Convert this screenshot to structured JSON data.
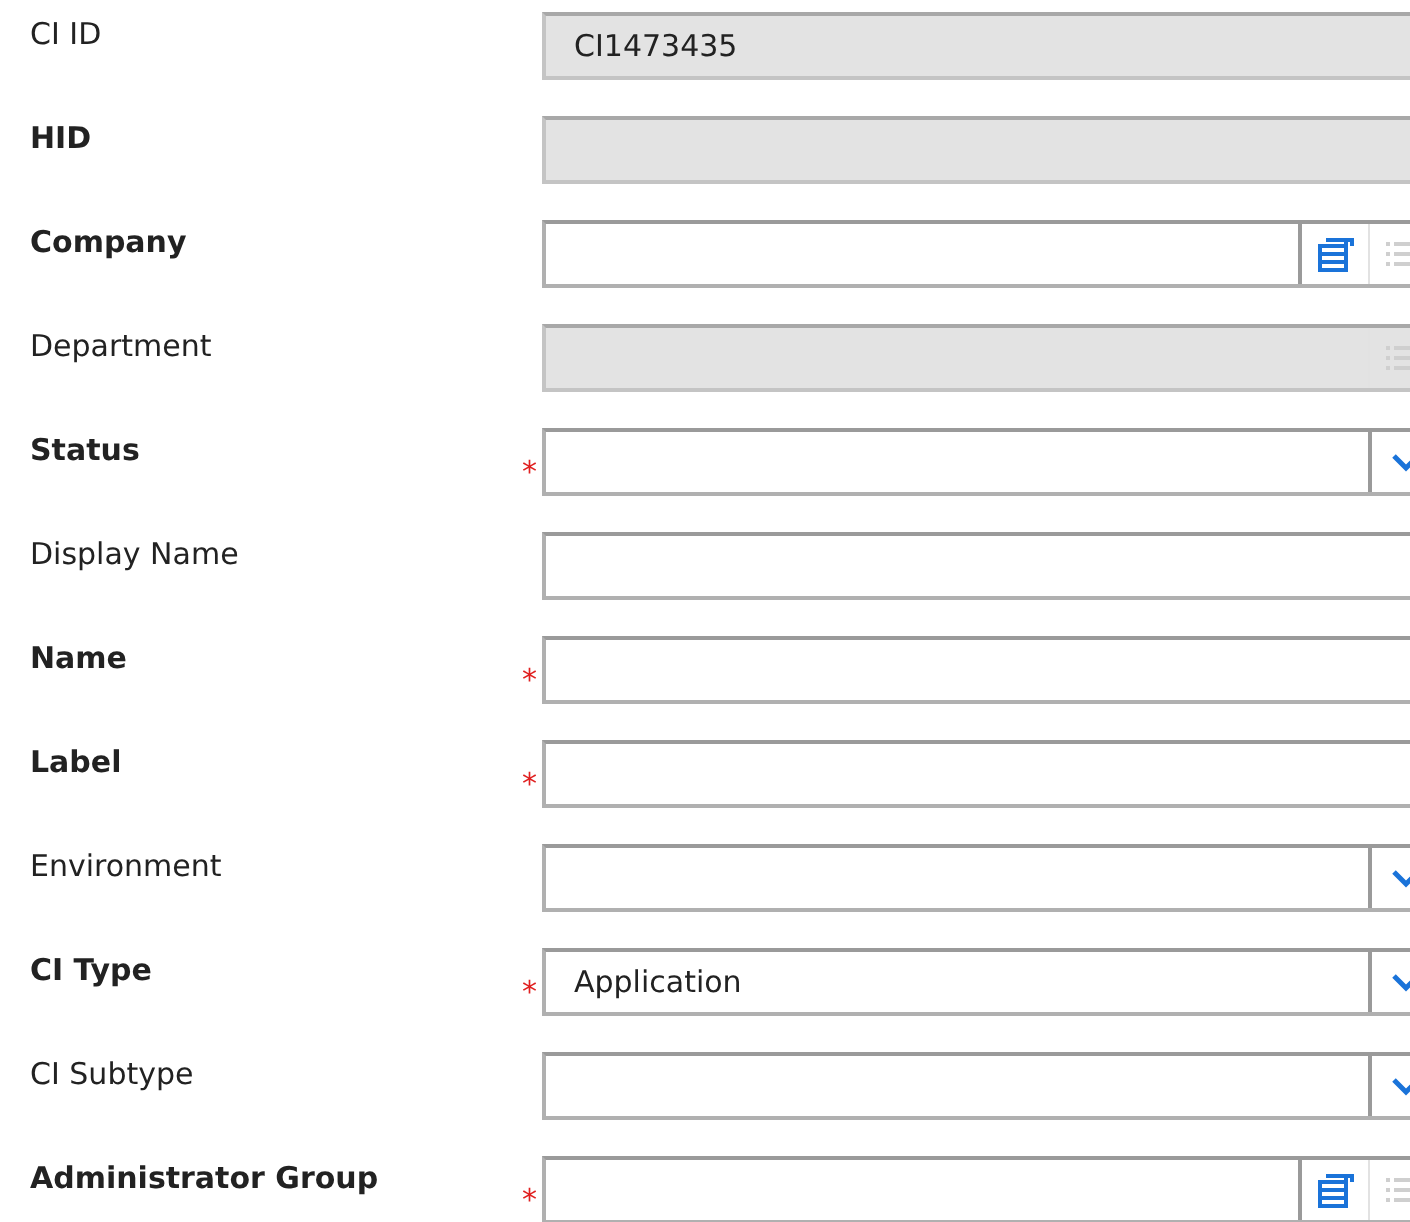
{
  "fields": [
    {
      "label": "CI ID",
      "bold": false,
      "kind": "text",
      "disabled": true,
      "value": "CI1473435"
    },
    {
      "label": "HID",
      "bold": true,
      "kind": "text",
      "disabled": true
    },
    {
      "label": "Company",
      "bold": true,
      "kind": "lookup",
      "disabled": false
    },
    {
      "label": "Department",
      "bold": false,
      "kind": "lookup",
      "disabled": true
    },
    {
      "label": "Status",
      "bold": true,
      "required_mark": "*",
      "kind": "dropdown",
      "disabled": false
    },
    {
      "label": "Display Name",
      "bold": false,
      "kind": "text",
      "disabled": false
    },
    {
      "label": "Name",
      "bold": true,
      "required_mark": "*",
      "kind": "text",
      "disabled": false
    },
    {
      "label": "Label",
      "bold": true,
      "required_mark": "*",
      "kind": "text",
      "disabled": false
    },
    {
      "label": "Environment",
      "bold": false,
      "kind": "dropdown",
      "disabled": false
    },
    {
      "label": "CI Type",
      "bold": true,
      "required_mark": "*",
      "kind": "dropdown",
      "disabled": false,
      "value": "Application"
    },
    {
      "label": "CI Subtype",
      "bold": false,
      "kind": "dropdown",
      "disabled": false
    },
    {
      "label": "Administrator Group",
      "bold": true,
      "required_mark": "*",
      "kind": "lookup",
      "disabled": false
    }
  ]
}
